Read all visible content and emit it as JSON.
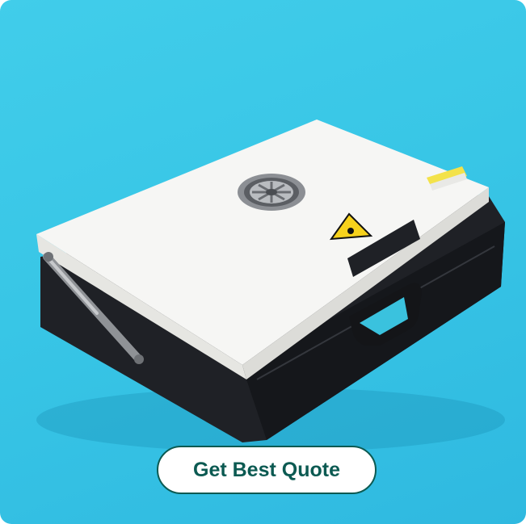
{
  "product": {
    "image_icon": "heat-press-drawer-machine",
    "background_color": "#3ccbe9",
    "cta_label": "Get Best Quote",
    "cta_color": "#0c5a52"
  }
}
